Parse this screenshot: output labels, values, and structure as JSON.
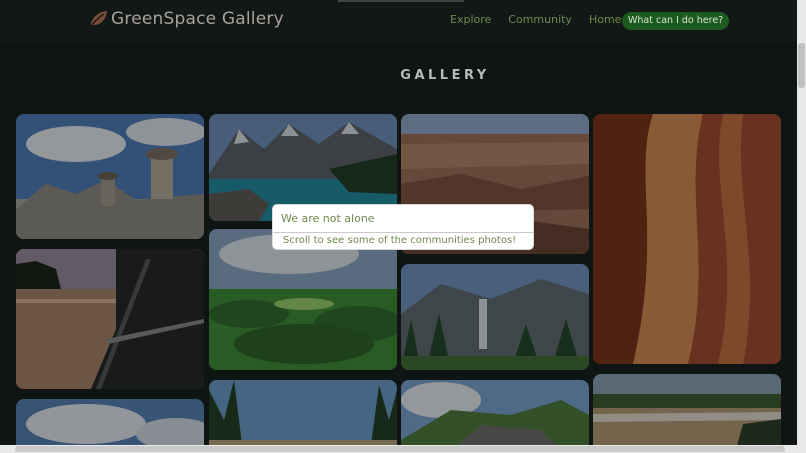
{
  "brand": {
    "name": "GreenSpace Gallery",
    "icon": "leaf-icon"
  },
  "nav": {
    "items": [
      "Explore",
      "Community",
      "Home"
    ],
    "help": "What can I do here?"
  },
  "page": {
    "heading": "GALLERY"
  },
  "tooltip": {
    "title": "We are not alone",
    "body": "Scroll to see some of the communities photos!"
  },
  "colors": {
    "background": "#0f1513",
    "accent_green": "#6f8a4d",
    "pill_green": "#1c5a1f",
    "brand_text": "#a9a19a"
  }
}
